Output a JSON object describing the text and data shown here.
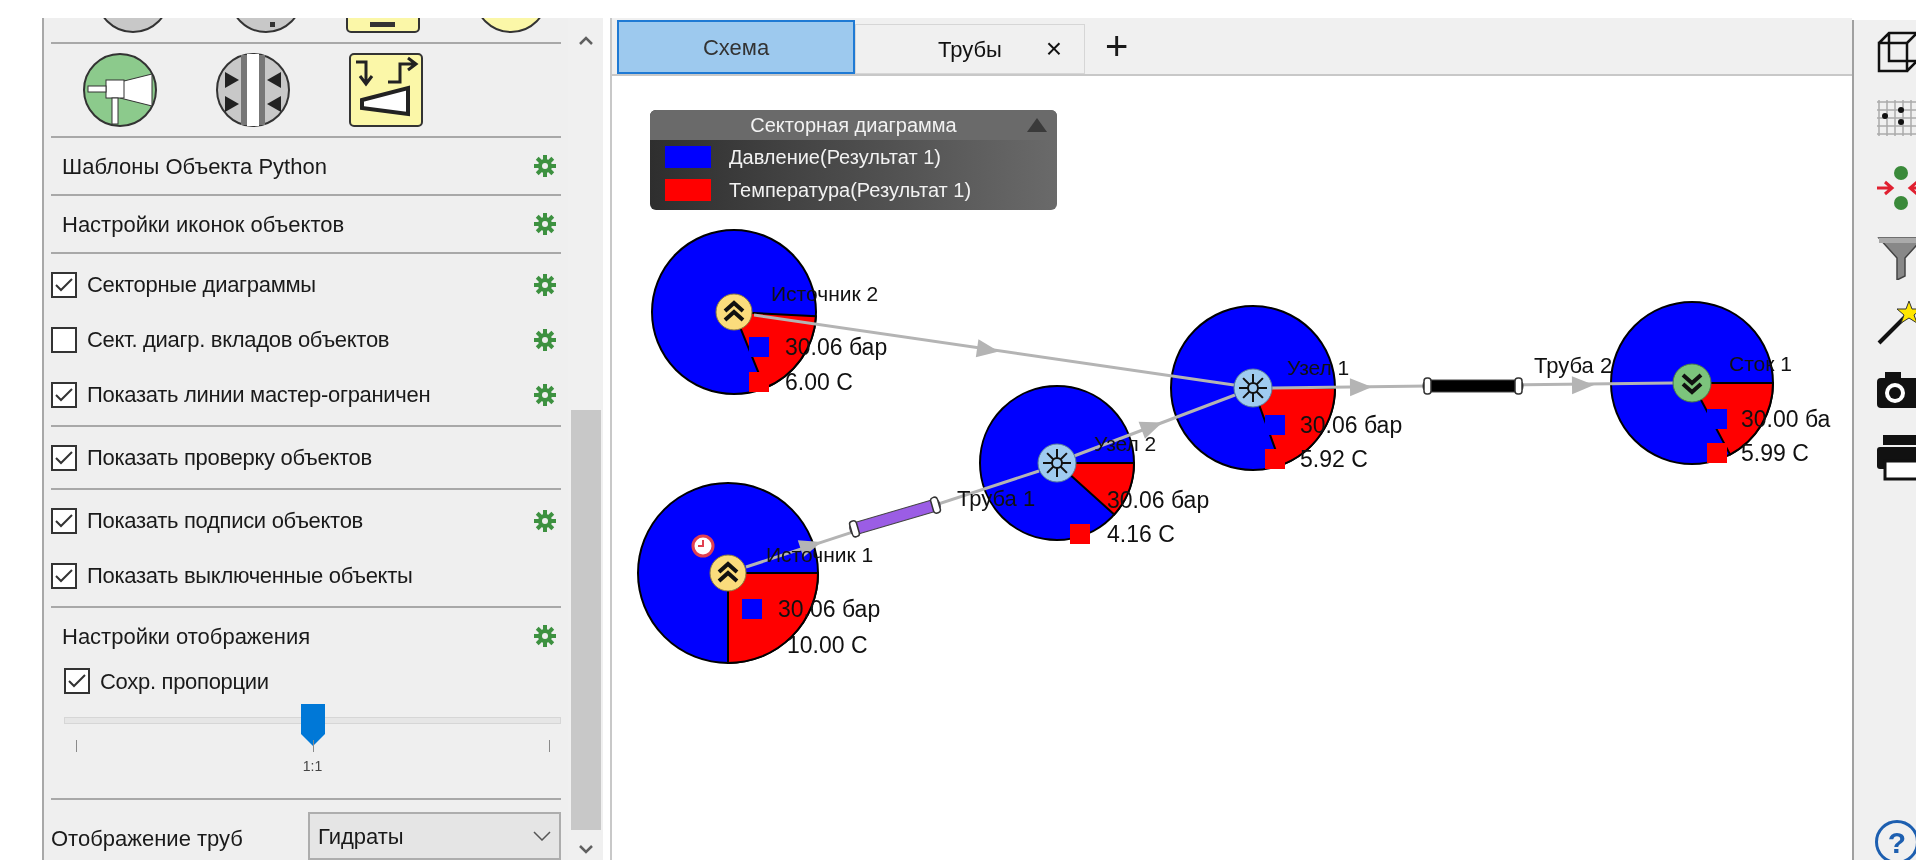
{
  "side_panel": {
    "groups": [
      {
        "items": [
          {
            "kind": "header",
            "label": "Шаблоны Объекта Python",
            "settings": true
          }
        ]
      },
      {
        "items": [
          {
            "kind": "header",
            "label": "Настройки иконок объектов",
            "settings": true
          }
        ]
      },
      {
        "items": [
          {
            "kind": "check",
            "label": "Секторные диаграммы",
            "checked": true,
            "settings": true
          },
          {
            "kind": "check",
            "label": "Сект. диагр. вкладов объектов",
            "checked": false,
            "settings": true
          },
          {
            "kind": "check",
            "label": "Показать линии мастер-ограничен",
            "checked": true,
            "settings": true
          }
        ]
      },
      {
        "items": [
          {
            "kind": "check",
            "label": "Показать проверку объектов",
            "checked": true,
            "settings": false
          }
        ]
      },
      {
        "items": [
          {
            "kind": "check",
            "label": "Показать подписи объектов",
            "checked": true,
            "settings": true
          },
          {
            "kind": "check",
            "label": "Показать выключенные объекты",
            "checked": true,
            "settings": false
          }
        ]
      },
      {
        "items": [
          {
            "kind": "header",
            "label": "Настройки отображения",
            "settings": true
          },
          {
            "kind": "subcheck",
            "label": "Сохр. пропорции",
            "checked": true
          },
          {
            "kind": "slider",
            "level": 0.5,
            "tick_label": "1:1"
          }
        ]
      }
    ],
    "pipe_display": {
      "label": "Отображение труб",
      "value": "Гидраты"
    }
  },
  "tabs": [
    {
      "label": "Схема",
      "selected": true
    },
    {
      "label": "Трубы",
      "selected": false,
      "close": "×"
    }
  ],
  "add_tab": "+",
  "legend": {
    "title": "Секторная диаграмма",
    "items": [
      {
        "label": "Давление(Результат 1)",
        "color": "#0000ff"
      },
      {
        "label": "Температура(Результат 1)",
        "color": "#ff0000"
      }
    ]
  },
  "diagram": {
    "nodes": [
      {
        "kind": "source",
        "name": "Источник 2",
        "pressure": "30.06 бар",
        "temperature": "6.00 С",
        "timer": false
      },
      {
        "kind": "junction",
        "name": "Узел 1",
        "pressure": "30.06 бар",
        "temperature": "5.92 С",
        "timer": false
      },
      {
        "kind": "sink",
        "name": "Сток 1",
        "pressure": "30.00 ба",
        "temperature": "5.99 С",
        "timer": false
      },
      {
        "kind": "junction",
        "name": "Узел 2",
        "pressure": "30.06 бар",
        "temperature": "4.16 С",
        "timer": false
      },
      {
        "kind": "source",
        "name": "Источник 1",
        "pressure": "30.06 бар",
        "temperature": "10.00 С",
        "timer": true
      }
    ],
    "pipes": [
      {
        "name": "Труба 1",
        "color": "#9b5de5"
      },
      {
        "name": "Труба 2",
        "color": "#000000"
      }
    ]
  },
  "help": "?"
}
